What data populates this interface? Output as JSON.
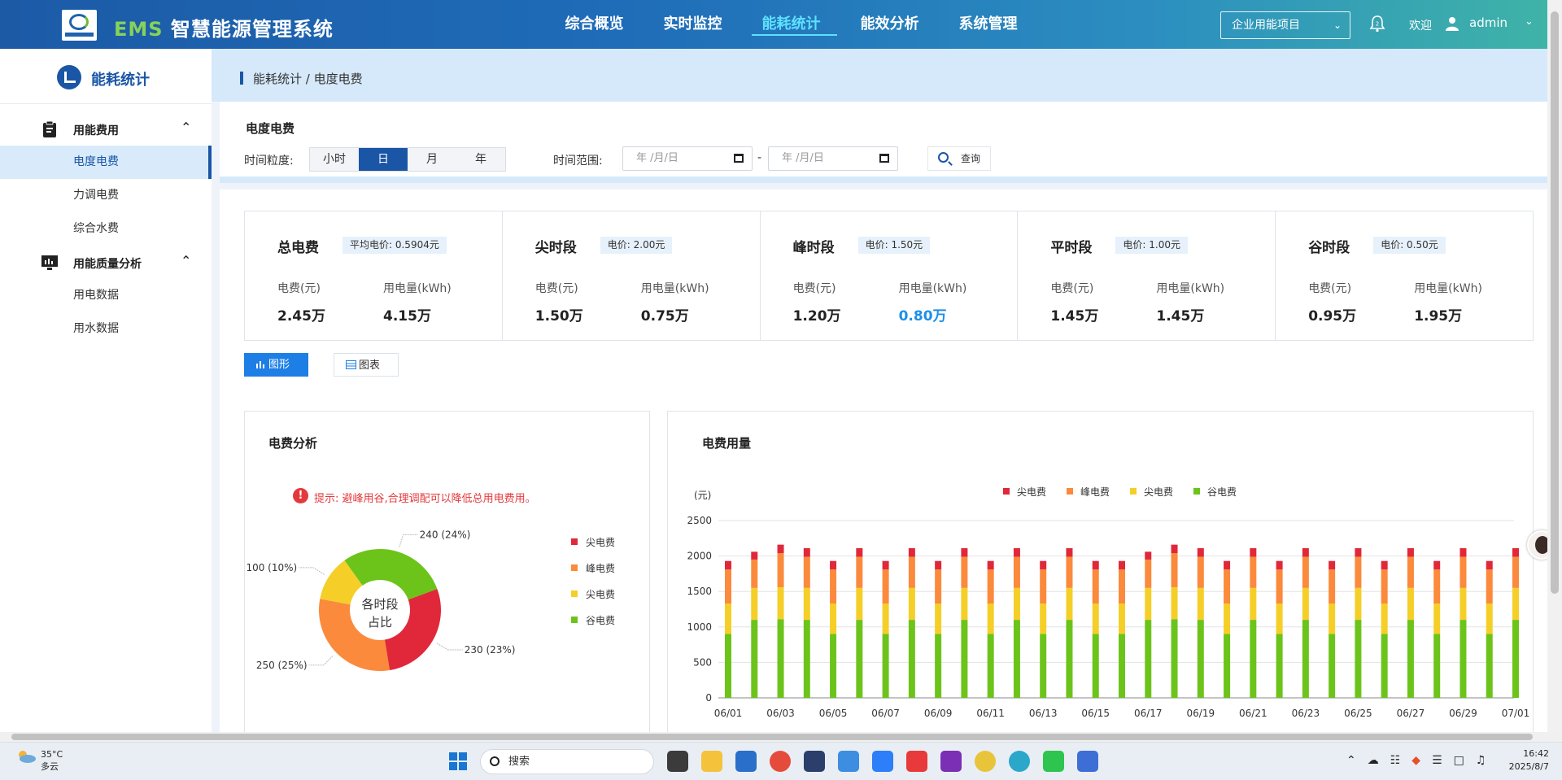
{
  "header": {
    "brand_prefix": "EMS",
    "brand_title": "智慧能源管理系统",
    "nav": [
      {
        "label": "综合概览",
        "active": false
      },
      {
        "label": "实时监控",
        "active": false
      },
      {
        "label": "能耗统计",
        "active": true
      },
      {
        "label": "能效分析",
        "active": false
      },
      {
        "label": "系统管理",
        "active": false
      }
    ],
    "project_select": "企业用能项目",
    "notification_count": "2",
    "welcome": "欢迎",
    "username": "admin"
  },
  "sidebar": {
    "title": "能耗统计",
    "groups": [
      {
        "label": "用能费用",
        "items": [
          {
            "label": "电度电费",
            "active": true
          },
          {
            "label": "力调电费",
            "active": false
          },
          {
            "label": "综合水费",
            "active": false
          }
        ]
      },
      {
        "label": "用能质量分析",
        "items": [
          {
            "label": "用电数据",
            "active": false
          },
          {
            "label": "用水数据",
            "active": false
          }
        ]
      }
    ]
  },
  "breadcrumb": "能耗统计 / 电度电费",
  "filter": {
    "title": "电度电费",
    "granularity_label": "时间粒度:",
    "granularity_options": [
      "小时",
      "日",
      "月",
      "年"
    ],
    "granularity_selected": "日",
    "range_label": "时间范围:",
    "date_placeholder_start": "年 /月/日",
    "date_placeholder_end": "年 /月/日",
    "range_separator": "-",
    "query_label": "查询"
  },
  "summary_cards": [
    {
      "name": "总电费",
      "price": "平均电价: 0.5904元",
      "fee_label": "电费(元)",
      "usage_label": "用电量(kWh)",
      "fee": "2.45万",
      "usage": "4.15万",
      "usage_highlight": false
    },
    {
      "name": "尖时段",
      "price": "电价: 2.00元",
      "fee_label": "电费(元)",
      "usage_label": "用电量(kWh)",
      "fee": "1.50万",
      "usage": "0.75万",
      "usage_highlight": false
    },
    {
      "name": "峰时段",
      "price": "电价: 1.50元",
      "fee_label": "电费(元)",
      "usage_label": "用电量(kWh)",
      "fee": "1.20万",
      "usage": "0.80万",
      "usage_highlight": true
    },
    {
      "name": "平时段",
      "price": "电价: 1.00元",
      "fee_label": "电费(元)",
      "usage_label": "用电量(kWh)",
      "fee": "1.45万",
      "usage": "1.45万",
      "usage_highlight": false
    },
    {
      "name": "谷时段",
      "price": "电价: 0.50元",
      "fee_label": "电费(元)",
      "usage_label": "用电量(kWh)",
      "fee": "0.95万",
      "usage": "1.95万",
      "usage_highlight": false
    }
  ],
  "view_tabs": {
    "graph": "图形",
    "table": "图表",
    "selected": "graph"
  },
  "fee_analysis": {
    "title": "电费分析",
    "tip": "提示: 避峰用谷,合理调配可以降低总用电费用。",
    "center_label_1": "各时段",
    "center_label_2": "占比"
  },
  "fee_usage": {
    "title": "电费用量"
  },
  "colors": {
    "jian": "#e0283a",
    "feng": "#fb8a3c",
    "ping": "#f5cf27",
    "gu": "#6cc41b",
    "primary": "#1a56a5"
  },
  "chart_data": [
    {
      "type": "pie",
      "title": "",
      "labels": [
        "尖电费",
        "峰电费",
        "尖电费",
        "谷电费"
      ],
      "slices": [
        {
          "name": "尖电费",
          "value": 230,
          "label": "230 (23%)",
          "color": "#e0283a"
        },
        {
          "name": "峰电费",
          "value": 250,
          "label": "250 (25%)",
          "color": "#fb8a3c"
        },
        {
          "name": "尖电费",
          "value": 100,
          "label": "100 (10%)",
          "color": "#f5cf27"
        },
        {
          "name": "谷电费",
          "value": 240,
          "label": "240 (24%)",
          "color": "#6cc41b"
        }
      ],
      "legend_position": "right"
    },
    {
      "type": "bar",
      "stacked": true,
      "title": "",
      "ylabel": "(元)",
      "ylim": [
        0,
        2500
      ],
      "yticks": [
        0,
        500,
        1000,
        1500,
        2000,
        2500
      ],
      "grid": true,
      "legend_position": "top",
      "categories": [
        "06/01",
        "06/02",
        "06/03",
        "06/04",
        "06/05",
        "06/06",
        "06/07",
        "06/08",
        "06/09",
        "06/10",
        "06/11",
        "06/12",
        "06/13",
        "06/14",
        "06/15",
        "06/16",
        "06/17",
        "06/18",
        "06/19",
        "06/20",
        "06/21",
        "06/22",
        "06/23",
        "06/24",
        "06/25",
        "06/26",
        "06/27",
        "06/28",
        "06/29",
        "06/30",
        "07/01"
      ],
      "tick_labels": [
        "06/01",
        "06/03",
        "06/05",
        "06/07",
        "06/09",
        "06/11",
        "06/13",
        "06/15",
        "06/17",
        "06/19",
        "06/21",
        "06/23",
        "06/25",
        "06/27",
        "06/29",
        "07/01"
      ],
      "series": [
        {
          "name": "谷电费",
          "color": "#6cc41b",
          "values": [
            900,
            1100,
            1110,
            1100,
            900,
            1100,
            900,
            1100,
            900,
            1100,
            900,
            1100,
            900,
            1100,
            900,
            900,
            1100,
            1110,
            1100,
            900,
            1100,
            900,
            1100,
            900,
            1100,
            900,
            1100,
            900,
            1100,
            900,
            1100
          ]
        },
        {
          "name": "尖电费",
          "color": "#f5cf27",
          "values": [
            430,
            450,
            450,
            450,
            430,
            450,
            430,
            450,
            430,
            450,
            430,
            450,
            430,
            450,
            430,
            430,
            450,
            450,
            450,
            430,
            450,
            430,
            450,
            430,
            450,
            430,
            450,
            430,
            450,
            430,
            450
          ]
        },
        {
          "name": "峰电费",
          "color": "#fb8a3c",
          "values": [
            480,
            400,
            480,
            440,
            480,
            440,
            480,
            440,
            480,
            440,
            480,
            440,
            480,
            440,
            480,
            480,
            400,
            480,
            440,
            480,
            440,
            480,
            440,
            480,
            440,
            480,
            440,
            480,
            440,
            480,
            440
          ]
        },
        {
          "name": "尖电费",
          "color": "#e0283a",
          "values": [
            120,
            110,
            120,
            120,
            120,
            120,
            120,
            120,
            120,
            120,
            120,
            120,
            120,
            120,
            120,
            120,
            110,
            120,
            120,
            120,
            120,
            120,
            120,
            120,
            120,
            120,
            120,
            120,
            120,
            120,
            120
          ]
        }
      ],
      "legend": [
        {
          "name": "尖电费",
          "color": "#e0283a"
        },
        {
          "name": "峰电费",
          "color": "#fb8a3c"
        },
        {
          "name": "尖电费",
          "color": "#f5cf27"
        },
        {
          "name": "谷电费",
          "color": "#6cc41b"
        }
      ]
    }
  ],
  "taskbar": {
    "temperature": "35°C",
    "weather": "多云",
    "search": "搜索",
    "time": "16:42",
    "date": "2025/8/7"
  }
}
